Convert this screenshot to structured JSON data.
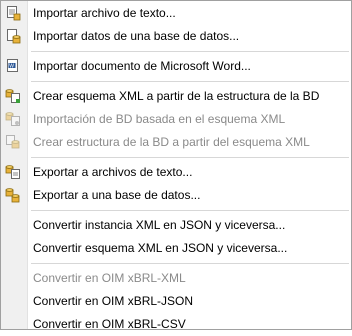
{
  "menu": {
    "groups": [
      {
        "items": [
          {
            "label": "Importar archivo de texto...",
            "icon": "text-import-icon",
            "enabled": true
          },
          {
            "label": "Importar datos de una base de datos...",
            "icon": "database-import-icon",
            "enabled": true
          }
        ]
      },
      {
        "items": [
          {
            "label": "Importar documento de Microsoft Word...",
            "icon": "word-import-icon",
            "enabled": true
          }
        ]
      },
      {
        "items": [
          {
            "label": "Crear esquema XML a partir de la estructura de la BD",
            "icon": "schema-from-db-icon",
            "enabled": true
          },
          {
            "label": "Importación de BD basada en el esquema XML",
            "icon": "db-import-schema-icon",
            "enabled": false
          },
          {
            "label": "Crear estructura de la BD a partir del esquema XML",
            "icon": "db-structure-icon",
            "enabled": false
          }
        ]
      },
      {
        "items": [
          {
            "label": "Exportar a archivos de texto...",
            "icon": "text-export-icon",
            "enabled": true
          },
          {
            "label": "Exportar a una base de datos...",
            "icon": "database-export-icon",
            "enabled": true
          }
        ]
      },
      {
        "items": [
          {
            "label": "Convertir instancia XML en JSON y viceversa...",
            "enabled": true
          },
          {
            "label": "Convertir esquema XML en JSON y viceversa...",
            "enabled": true
          }
        ]
      },
      {
        "items": [
          {
            "label": "Convertir en OIM xBRL-XML",
            "enabled": false
          },
          {
            "label": "Convertir en OIM xBRL-JSON",
            "enabled": true
          },
          {
            "label": "Convertir en OIM xBRL-CSV",
            "enabled": true
          }
        ]
      }
    ]
  }
}
